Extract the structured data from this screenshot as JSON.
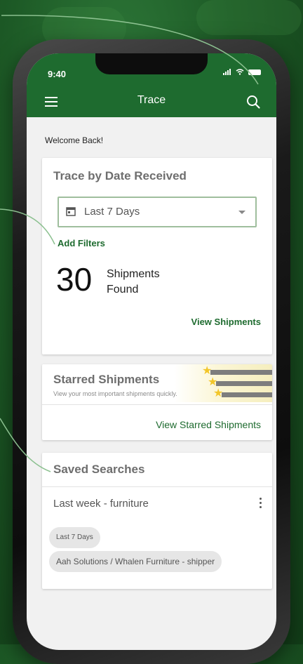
{
  "status": {
    "time": "9:40"
  },
  "appbar": {
    "title": "Trace"
  },
  "welcome": "Welcome Back!",
  "trace_card": {
    "title": "Trace by Date Received",
    "date_range": "Last 7 Days",
    "add_filters": "Add Filters",
    "count": "30",
    "count_label": "Shipments Found",
    "view_link": "View Shipments"
  },
  "starred_card": {
    "title": "Starred Shipments",
    "subtitle": "View your most important shipments quickly.",
    "view_link": "View Starred Shipments"
  },
  "saved_card": {
    "title": "Saved Searches",
    "item_name": "Last week - furniture",
    "chips": [
      "Last 7 Days",
      "Aah Solutions / Whalen Furniture - shipper"
    ]
  },
  "colors": {
    "brand": "#1e6b2f",
    "background": "#1d5a26",
    "star": "#f2c62a"
  },
  "icons": [
    "menu-icon",
    "search-icon",
    "calendar-icon",
    "chevron-down-icon",
    "star-icon",
    "more-vert-icon"
  ]
}
